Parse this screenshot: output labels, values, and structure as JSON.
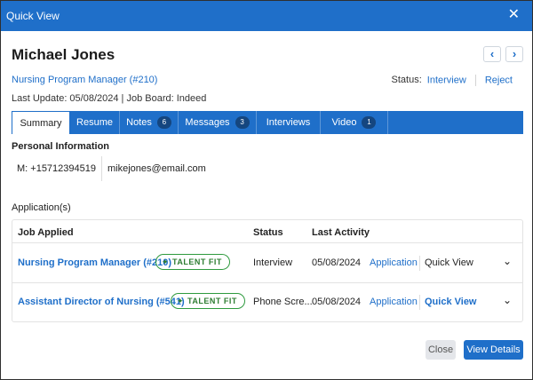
{
  "dialog": {
    "title": "Quick View",
    "close_glyph": "✕"
  },
  "candidate": {
    "name": "Michael Jones",
    "job_title": "Nursing Program Manager (#210)",
    "status_label": "Status:",
    "status_value": "Interview",
    "reject_label": "Reject",
    "last_update": "Last Update: 05/08/2024 | Job Board: Indeed",
    "prev_glyph": "‹",
    "next_glyph": "›"
  },
  "tabs": [
    {
      "label": "Summary",
      "badge": ""
    },
    {
      "label": "Resume",
      "badge": ""
    },
    {
      "label": "Notes",
      "badge": "6"
    },
    {
      "label": "Messages",
      "badge": "3"
    },
    {
      "label": "Interviews",
      "badge": ""
    },
    {
      "label": "Video",
      "badge": "1"
    }
  ],
  "personal": {
    "section_title": "Personal Information",
    "phone": "M: +15712394519",
    "email": "mikejones@email.com"
  },
  "applications": {
    "section_title": "Application(s)",
    "headers": {
      "job": "Job Applied",
      "status": "Status",
      "activity": "Last Activity"
    },
    "fit_label": "TALENT FIT",
    "rows": [
      {
        "job": "Nursing Program Manager (#210)",
        "status": "Interview",
        "activity": "05/08/2024",
        "application": "Application",
        "quick_view": "Quick View"
      },
      {
        "job": "Assistant Director of Nursing (#541)",
        "status": "Phone Scre...",
        "activity": "05/08/2024",
        "application": "Application",
        "quick_view": "Quick View"
      }
    ]
  },
  "footer": {
    "close_label": "Close",
    "view_details_label": "View Details"
  },
  "colors": {
    "primary": "#1f6fc9",
    "badge": "#15467f",
    "fit_green": "#2e9a3e"
  }
}
